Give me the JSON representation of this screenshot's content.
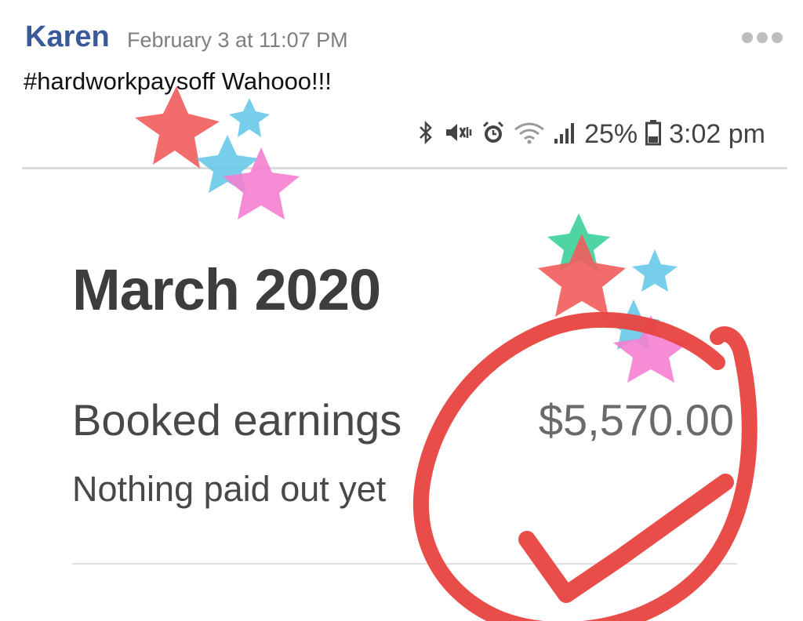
{
  "post": {
    "author": "Karen",
    "timestamp": "February 3 at 11:07 PM",
    "caption": "#hardworkpaysoff Wahooo!!!"
  },
  "status_bar": {
    "battery": "25%",
    "time": "3:02 pm",
    "icons": [
      "bluetooth-icon",
      "vibrate-icon",
      "alarm-icon",
      "wifi-icon",
      "signal-icon",
      "battery-icon"
    ]
  },
  "earnings": {
    "month": "March 2020",
    "label": "Booked earnings",
    "amount": "$5,570.00",
    "sub": "Nothing paid out yet"
  },
  "decorations": {
    "star_colors": [
      "#f25c5c",
      "#f47fd0",
      "#5ec6e6",
      "#3ccf9a"
    ],
    "circle_color": "#e8433f"
  }
}
